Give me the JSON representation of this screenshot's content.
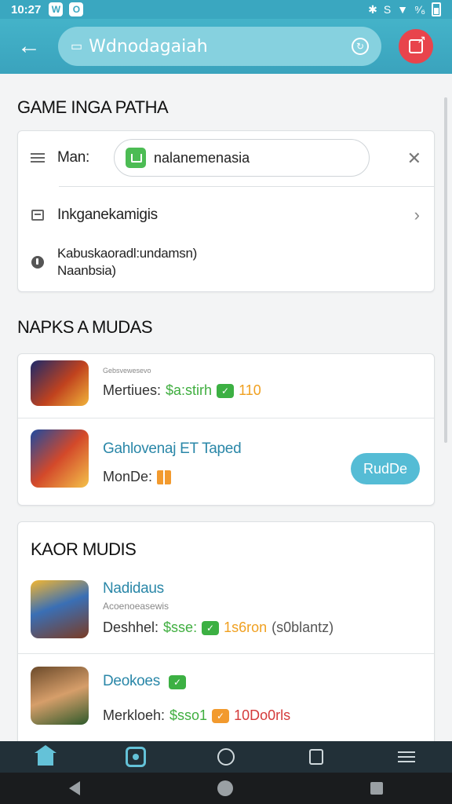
{
  "status": {
    "time": "10:27",
    "badges": [
      "W",
      "O"
    ],
    "right": [
      "✱",
      "S",
      "▼",
      "⁹⁄₆"
    ]
  },
  "appbar": {
    "url": "Wdnodagaiah"
  },
  "filter": {
    "title": "GAME INGA PATHA",
    "search_label": "Man:",
    "search_value": "nalanemenasia",
    "row2_label": "Inkganekamigis",
    "row3_line1": "Kabuskaoradl:undamsn)",
    "row3_line2": "Naanbsia)"
  },
  "section2": {
    "title": "NAPKS A MUDAS",
    "items": [
      {
        "sub": "Gebsvewesevo",
        "meta_label": "Mertiues:",
        "price": "$a:stirh",
        "badge": "✓",
        "count": "110"
      },
      {
        "title": "Gahlovenaj ET Taped",
        "meta_label": "MonDe:",
        "button": "RudDe"
      }
    ]
  },
  "section3": {
    "title": "KAOR MUDIS",
    "items": [
      {
        "title": "Nadidaus",
        "sub": "Acoenoeasewis",
        "meta_label": "Deshhel:",
        "price": "$sse:",
        "count": "1s6ron",
        "extra": "(s0blantz)"
      },
      {
        "title": "Deokoes",
        "meta_label": "Merkloeh:",
        "price": "$sso1",
        "count": "10Do0rls"
      }
    ]
  },
  "icons": {
    "back": "arrow-left-icon",
    "lock": "lock-icon",
    "reload": "reload-icon",
    "share": "share-icon"
  },
  "colors": {
    "appbar": "#3aa7c0",
    "accent": "#55bcd5",
    "danger": "#e8444c"
  }
}
